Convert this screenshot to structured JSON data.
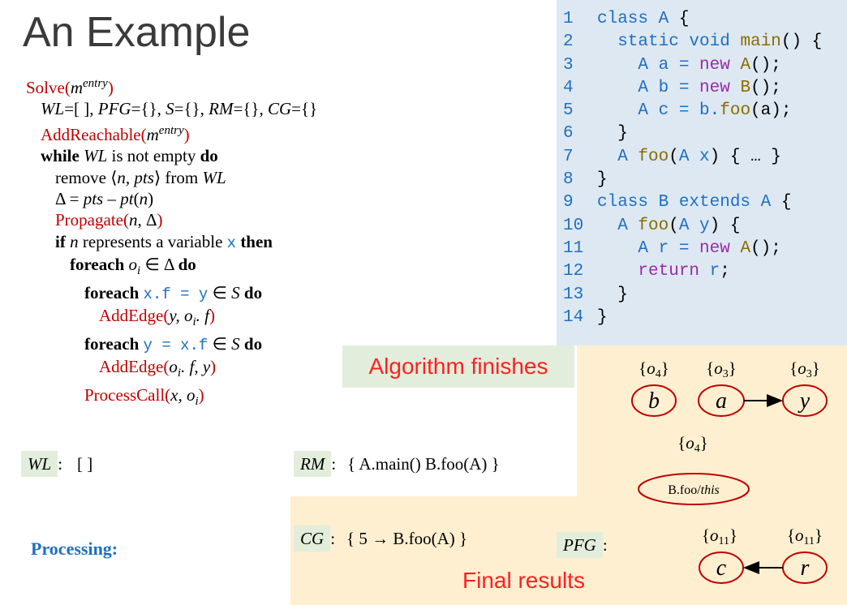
{
  "title": "An Example",
  "algorithm": {
    "lines": [
      {
        "indent": 0,
        "parts": [
          [
            "fn",
            "Solve("
          ],
          [
            "it",
            "m"
          ],
          [
            "sup",
            "entry"
          ],
          [
            "fn",
            ")"
          ]
        ]
      },
      {
        "indent": 1,
        "parts": [
          [
            "it",
            "WL"
          ],
          [
            "n",
            "=[ ], "
          ],
          [
            "it",
            "PFG"
          ],
          [
            "n",
            "={}, "
          ],
          [
            "it",
            "S"
          ],
          [
            "n",
            "={}, "
          ],
          [
            "it",
            "RM"
          ],
          [
            "n",
            "={}, "
          ],
          [
            "it",
            "CG"
          ],
          [
            "n",
            "={}"
          ]
        ]
      },
      {
        "indent": 1,
        "parts": [
          [
            "fn",
            "AddReachable("
          ],
          [
            "it",
            "m"
          ],
          [
            "sup",
            "entry"
          ],
          [
            "fn",
            ")"
          ]
        ]
      },
      {
        "indent": 1,
        "parts": [
          [
            "kw",
            "while "
          ],
          [
            "it",
            "WL"
          ],
          [
            "n",
            " is not empty "
          ],
          [
            "kw",
            "do"
          ]
        ]
      },
      {
        "indent": 2,
        "parts": [
          [
            "n",
            "remove ⟨"
          ],
          [
            "it",
            "n, pts"
          ],
          [
            "n",
            "⟩ from "
          ],
          [
            "it",
            "WL"
          ]
        ]
      },
      {
        "indent": 2,
        "parts": [
          [
            "n",
            "Δ = "
          ],
          [
            "it",
            "pts"
          ],
          [
            "n",
            " – "
          ],
          [
            "it",
            "pt"
          ],
          [
            "n",
            "("
          ],
          [
            "it",
            "n"
          ],
          [
            "n",
            ")"
          ]
        ]
      },
      {
        "indent": 2,
        "parts": [
          [
            "fn",
            "Propagate("
          ],
          [
            "it",
            "n"
          ],
          [
            "n",
            ", Δ"
          ],
          [
            "fn",
            ")"
          ]
        ]
      },
      {
        "indent": 2,
        "parts": [
          [
            "kw",
            "if "
          ],
          [
            "it",
            "n"
          ],
          [
            "n",
            " represents a variable "
          ],
          [
            "code",
            "x"
          ],
          [
            "kw",
            " then"
          ]
        ]
      },
      {
        "indent": 3,
        "parts": [
          [
            "kw",
            "foreach "
          ],
          [
            "it",
            "o"
          ],
          [
            "sub",
            "i"
          ],
          [
            "n",
            " ∈ Δ "
          ],
          [
            "kw",
            "do"
          ]
        ]
      },
      {
        "indent": 4,
        "parts": [
          [
            "kw",
            "foreach "
          ],
          [
            "code",
            "x.f = y"
          ],
          [
            "n",
            " ∈ "
          ],
          [
            "it",
            "S"
          ],
          [
            "kw",
            " do"
          ]
        ]
      },
      {
        "indent": 5,
        "parts": [
          [
            "fn",
            "AddEdge("
          ],
          [
            "it",
            "y, o"
          ],
          [
            "sub",
            "i"
          ],
          [
            "it",
            ". f"
          ],
          [
            "fn",
            ")"
          ]
        ]
      },
      {
        "indent": 4,
        "parts": [
          [
            "kw",
            "foreach "
          ],
          [
            "code",
            "y = x.f"
          ],
          [
            "n",
            " ∈ "
          ],
          [
            "it",
            "S"
          ],
          [
            "kw",
            " do"
          ]
        ]
      },
      {
        "indent": 5,
        "parts": [
          [
            "fn",
            "AddEdge("
          ],
          [
            "it",
            "o"
          ],
          [
            "sub",
            "i"
          ],
          [
            "it",
            ". f, y"
          ],
          [
            "fn",
            ")"
          ]
        ]
      },
      {
        "indent": 4,
        "parts": [
          [
            "fn",
            "ProcessCall("
          ],
          [
            "it",
            "x, o"
          ],
          [
            "sub",
            "i"
          ],
          [
            "fn",
            ")"
          ]
        ]
      }
    ]
  },
  "code": {
    "lines": [
      {
        "num": "1",
        "parts": [
          [
            "k",
            "class A "
          ],
          [
            "p",
            "{"
          ]
        ]
      },
      {
        "num": "2",
        "parts": [
          [
            "k",
            "  static void "
          ],
          [
            "f",
            "main"
          ],
          [
            "p",
            "() {"
          ]
        ]
      },
      {
        "num": "3",
        "parts": [
          [
            "k",
            "    A a = "
          ],
          [
            "n",
            "new "
          ],
          [
            "f",
            "A"
          ],
          [
            "p",
            "();"
          ]
        ]
      },
      {
        "num": "4",
        "parts": [
          [
            "k",
            "    A b = "
          ],
          [
            "n",
            "new "
          ],
          [
            "f",
            "B"
          ],
          [
            "p",
            "();"
          ]
        ]
      },
      {
        "num": "5",
        "parts": [
          [
            "k",
            "    A c = b."
          ],
          [
            "f",
            "foo"
          ],
          [
            "p",
            "(a);"
          ]
        ]
      },
      {
        "num": "6",
        "parts": [
          [
            "p",
            "  }"
          ]
        ]
      },
      {
        "num": "7",
        "parts": [
          [
            "k",
            "  A "
          ],
          [
            "f",
            "foo"
          ],
          [
            "p",
            "("
          ],
          [
            "k",
            "A x"
          ],
          [
            "p",
            ") { … }"
          ]
        ]
      },
      {
        "num": "8",
        "parts": [
          [
            "p",
            "}"
          ]
        ]
      },
      {
        "num": "9",
        "parts": [
          [
            "k",
            "class B extends A "
          ],
          [
            "p",
            "{"
          ]
        ]
      },
      {
        "num": "10",
        "parts": [
          [
            "k",
            "  A "
          ],
          [
            "f",
            "foo"
          ],
          [
            "p",
            "("
          ],
          [
            "k",
            "A y"
          ],
          [
            "p",
            ") {"
          ]
        ]
      },
      {
        "num": "11",
        "parts": [
          [
            "k",
            "    A r = "
          ],
          [
            "n",
            "new "
          ],
          [
            "f",
            "A"
          ],
          [
            "p",
            "();"
          ]
        ]
      },
      {
        "num": "12",
        "parts": [
          [
            "n",
            "    return "
          ],
          [
            "k",
            "r"
          ],
          [
            "p",
            ";"
          ]
        ]
      },
      {
        "num": "13",
        "parts": [
          [
            "p",
            "  }"
          ]
        ]
      },
      {
        "num": "14",
        "parts": [
          [
            "p",
            "}"
          ]
        ]
      }
    ]
  },
  "banner_finish": "Algorithm finishes",
  "banner_final": "Final results",
  "wl": {
    "label": "WL",
    "value": "[ ]"
  },
  "rm": {
    "label": "RM",
    "value": "{ A.main() B.foo(A) }"
  },
  "cg": {
    "label": "CG",
    "value": "{ 5 → B.foo(A) }"
  },
  "pfg": {
    "label": "PFG"
  },
  "processing": "Processing:",
  "graph": {
    "nodes": {
      "b": {
        "label": "b",
        "pts_o": "o",
        "pts_sub": "4"
      },
      "a": {
        "label": "a",
        "pts_o": "o",
        "pts_sub": "3"
      },
      "y": {
        "label": "y",
        "pts_o": "o",
        "pts_sub": "3"
      },
      "this": {
        "label_main": "B.foo/",
        "label_it": "this",
        "pts_o": "o",
        "pts_sub": "4"
      },
      "c": {
        "label": "c",
        "pts_o": "o",
        "pts_sub": "11"
      },
      "r": {
        "label": "r",
        "pts_o": "o",
        "pts_sub": "11"
      }
    },
    "node_stroke": "#c00000"
  }
}
